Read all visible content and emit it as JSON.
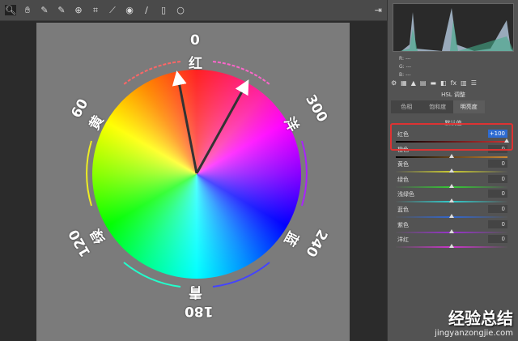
{
  "toolbar": {
    "tools": [
      "zoom-tool",
      "hand-tool",
      "eyedropper-tool",
      "color-sampler-tool",
      "target-adjust-tool",
      "crop-tool",
      "straighten-tool",
      "red-eye-tool",
      "brush-tool",
      "gradient-tool",
      "radial-tool"
    ],
    "exit_icon": "exit-icon"
  },
  "wheel": {
    "labels": {
      "red_deg": "0",
      "red": "红",
      "yellow_deg": "60",
      "yellow": "黄",
      "green_deg": "120",
      "green": "绿",
      "cyan_deg": "180",
      "cyan": "青",
      "blue_deg": "240",
      "blue": "蓝",
      "magenta_deg": "300",
      "magenta": "洋"
    }
  },
  "panel": {
    "rgb": {
      "r": "R:",
      "g": "G:",
      "b": "B:",
      "r_val": "---",
      "g_val": "---",
      "b_val": "---"
    },
    "title": "HSL 调整",
    "tabs": [
      "色相",
      "饱和度",
      "明亮度"
    ],
    "default": "默认值",
    "sliders": [
      {
        "name": "红色",
        "value": "+100"
      },
      {
        "name": "橙色",
        "value": "0"
      },
      {
        "name": "黄色",
        "value": "0"
      },
      {
        "name": "绿色",
        "value": "0"
      },
      {
        "name": "浅绿色",
        "value": "0"
      },
      {
        "name": "蓝色",
        "value": "0"
      },
      {
        "name": "紫色",
        "value": "0"
      },
      {
        "name": "洋红",
        "value": "0"
      }
    ]
  },
  "watermark": {
    "title": "经验总结",
    "url": "jingyanzongjie.com"
  }
}
